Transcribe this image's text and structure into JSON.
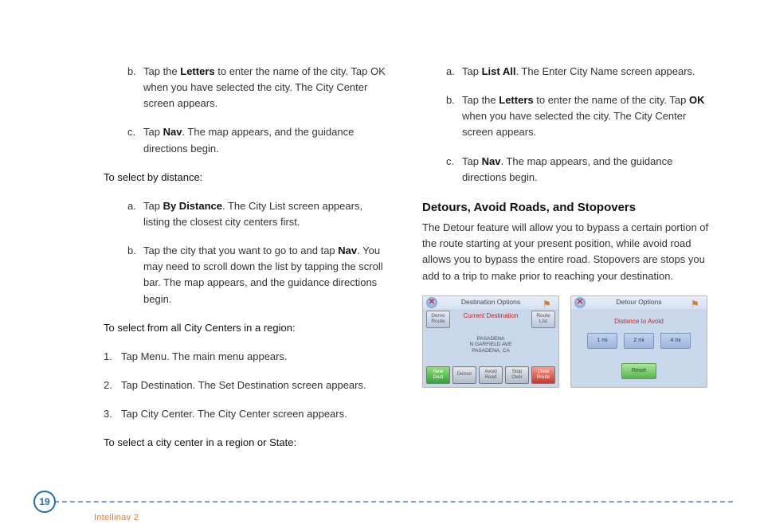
{
  "left": {
    "item_b_pre": "Tap the ",
    "item_b_bold": "Letters",
    "item_b_post": " to enter the name of the city. Tap OK when you have selected the city. The City Center screen appears.",
    "item_c_pre": "Tap ",
    "item_c_bold": "Nav",
    "item_c_post": ". The map appears, and the guidance directions begin.",
    "heading_distance": "To select by distance:",
    "dist_a_pre": "Tap ",
    "dist_a_bold": "By Distance",
    "dist_a_post": ". The City List screen appears, listing the closest city centers first.",
    "dist_b_pre": "Tap the city that you want to go to and tap ",
    "dist_b_bold": "Nav",
    "dist_b_post": ". You may need to scroll down the list by tapping the scroll bar. The map appears, and the guidance directions begin.",
    "heading_region": "To select from all City Centers in a region:",
    "step1": "Tap Menu. The main menu appears.",
    "step2": "Tap Destination. The Set Destination screen appears.",
    "step3": "Tap City Center. The City Center screen appears.",
    "heading_state": "To select a city center in a region or State:"
  },
  "right": {
    "a_pre": "Tap ",
    "a_bold": "List All",
    "a_post": ". The Enter City Name screen appears.",
    "b_pre": "Tap the ",
    "b_bold1": "Letters",
    "b_mid": " to enter the name of the city. Tap ",
    "b_bold2": "OK",
    "b_post": " when you have selected the city. The City Center screen appears.",
    "c_pre": "Tap ",
    "c_bold": "Nav",
    "c_post": ". The map appears, and the guidance directions begin.",
    "section_title": "Detours, Avoid Roads, and Stopovers",
    "section_body": "The Detour feature will allow you to bypass a certain portion of the route starting at your present position, while avoid road allows you to bypass the entire road. Stopovers are stops you add to a trip to make prior to reaching your destination."
  },
  "shot1": {
    "title": "Destination Options",
    "sub": "Current Destination",
    "addr_l1": "PASADENA",
    "addr_l2": "N GARFIELD AVE",
    "addr_l3": "PASADENA, CA",
    "btn_demo": "Demo\nRoute",
    "btn_routelist": "Route\nList",
    "btn_newdest": "New\nDest",
    "btn_detour": "Detour",
    "btn_avoid": "Avoid\nRoad",
    "btn_stopover": "Stop\nOver",
    "btn_clear": "Clear\nRoute"
  },
  "shot2": {
    "title": "Detour Options",
    "sub": "Distance to Avoid",
    "d1": "1 mi",
    "d2": "2 mi",
    "d3": "4 mi",
    "reset": "Reset"
  },
  "footer": {
    "page": "19",
    "label": "Intellinav 2"
  },
  "markers": {
    "a": "a.",
    "b": "b.",
    "c": "c.",
    "n1": "1.",
    "n2": "2.",
    "n3": "3."
  }
}
